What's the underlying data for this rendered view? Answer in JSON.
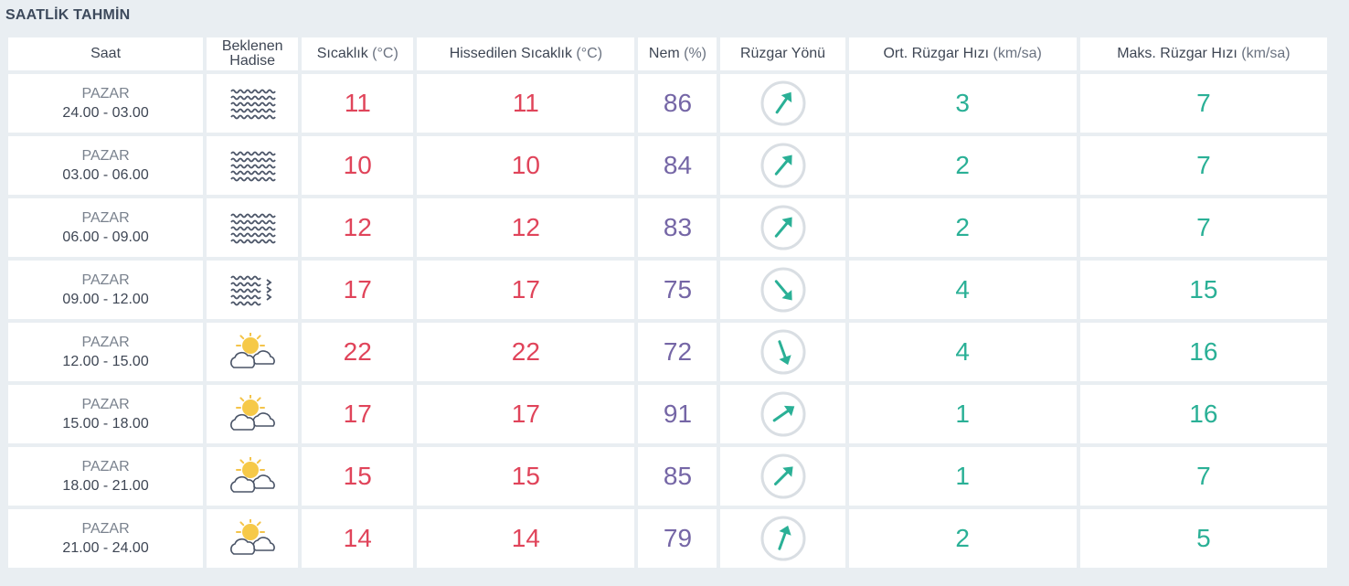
{
  "title": "SAATLİK TAHMİN",
  "headers": {
    "saat": "Saat",
    "hadise_1": "Beklenen",
    "hadise_2": "Hadise",
    "sicaklik": "Sıcaklık",
    "sicaklik_unit": "(°C)",
    "hissedilen": "Hissedilen Sıcaklık",
    "hissedilen_unit": "(°C)",
    "nem": "Nem",
    "nem_unit": "(%)",
    "ruzgar_yonu": "Rüzgar Yönü",
    "ort_ruzgar": "Ort. Rüzgar Hızı",
    "ort_ruzgar_unit": "(km/sa)",
    "maks_ruzgar": "Maks. Rüzgar Hızı",
    "maks_ruzgar_unit": "(km/sa)"
  },
  "colors": {
    "temperature": "#e0445a",
    "humidity": "#7566a6",
    "wind": "#2ab096",
    "title": "#3d4a5c"
  },
  "rows": [
    {
      "day": "PAZAR",
      "hours": "24.00 - 03.00",
      "icon": "fog-icon",
      "temp": "11",
      "feels": "11",
      "humidity": "86",
      "wind_dir_deg": 35,
      "wind_avg": "3",
      "wind_max": "7"
    },
    {
      "day": "PAZAR",
      "hours": "03.00 - 06.00",
      "icon": "fog-icon",
      "temp": "10",
      "feels": "10",
      "humidity": "84",
      "wind_dir_deg": 40,
      "wind_avg": "2",
      "wind_max": "7"
    },
    {
      "day": "PAZAR",
      "hours": "06.00 - 09.00",
      "icon": "fog-icon",
      "temp": "12",
      "feels": "12",
      "humidity": "83",
      "wind_dir_deg": 40,
      "wind_avg": "2",
      "wind_max": "7"
    },
    {
      "day": "PAZAR",
      "hours": "09.00 - 12.00",
      "icon": "fog-mist-icon",
      "temp": "17",
      "feels": "17",
      "humidity": "75",
      "wind_dir_deg": 140,
      "wind_avg": "4",
      "wind_max": "15"
    },
    {
      "day": "PAZAR",
      "hours": "12.00 - 15.00",
      "icon": "partly-cloudy-icon",
      "temp": "22",
      "feels": "22",
      "humidity": "72",
      "wind_dir_deg": 160,
      "wind_avg": "4",
      "wind_max": "16"
    },
    {
      "day": "PAZAR",
      "hours": "15.00 - 18.00",
      "icon": "partly-cloudy-icon",
      "temp": "17",
      "feels": "17",
      "humidity": "91",
      "wind_dir_deg": 55,
      "wind_avg": "1",
      "wind_max": "16"
    },
    {
      "day": "PAZAR",
      "hours": "18.00 - 21.00",
      "icon": "partly-cloudy-icon",
      "temp": "15",
      "feels": "15",
      "humidity": "85",
      "wind_dir_deg": 45,
      "wind_avg": "1",
      "wind_max": "7"
    },
    {
      "day": "PAZAR",
      "hours": "21.00 - 24.00",
      "icon": "partly-cloudy-icon",
      "temp": "14",
      "feels": "14",
      "humidity": "79",
      "wind_dir_deg": 20,
      "wind_avg": "2",
      "wind_max": "5"
    }
  ]
}
